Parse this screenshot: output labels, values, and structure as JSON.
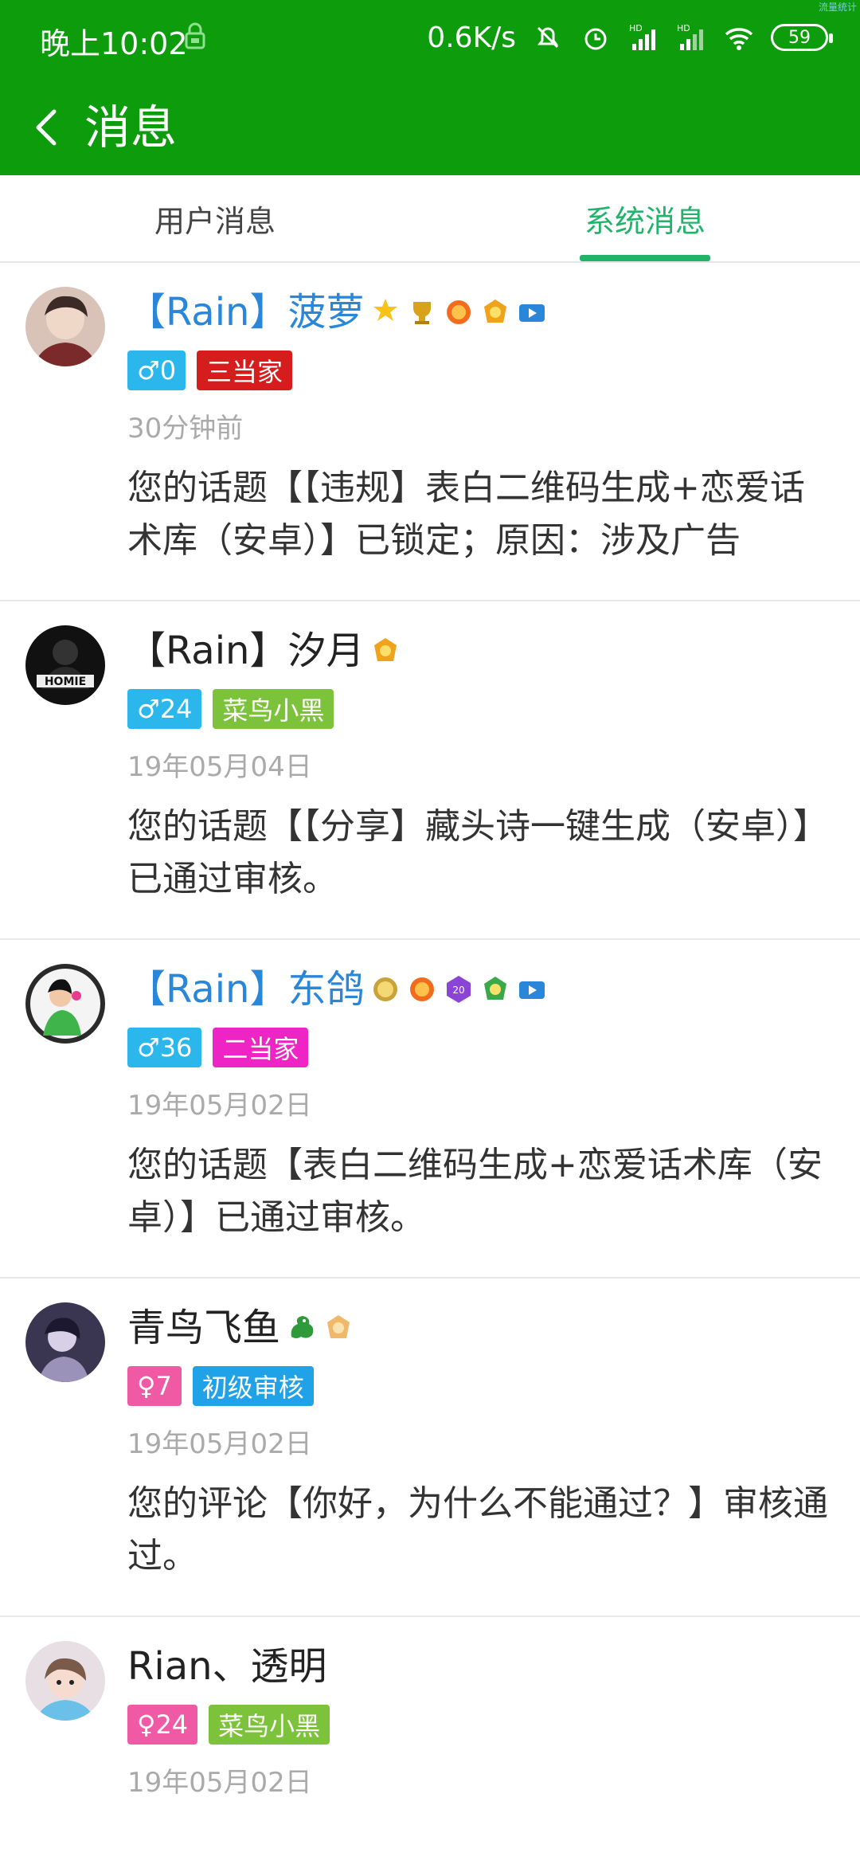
{
  "status_bar": {
    "time": "晚上10:02",
    "speed": "0.6K/s",
    "signal_1": "HD",
    "signal_2": "HD",
    "battery": "59",
    "top_right": "流量统计"
  },
  "app_bar": {
    "title": "消息"
  },
  "tabs": [
    {
      "label": "用户消息",
      "selected": false
    },
    {
      "label": "系统消息",
      "selected": true
    }
  ],
  "colors": {
    "primary": "#0c9c0c",
    "tab_active": "#21b36a",
    "name_blue": "#2a86d8"
  },
  "messages": [
    {
      "name": "【Rain】菠萝",
      "name_color": "blue",
      "gender": "♂",
      "level": "0",
      "role": "三当家",
      "time": "30分钟前",
      "text": "您的话题【【违规】表白二维码生成+恋爱话术库（安卓）】已锁定；原因：涉及广告"
    },
    {
      "name": "【Rain】汐月",
      "name_color": "black",
      "gender": "♂",
      "level": "24",
      "role": "菜鸟小黑",
      "time": "19年05月04日",
      "text": "您的话题【【分享】藏头诗一键生成（安卓）】已通过审核。"
    },
    {
      "name": "【Rain】东鸽",
      "name_color": "blue",
      "gender": "♂",
      "level": "36",
      "role": "二当家",
      "time": "19年05月02日",
      "text": "您的话题【表白二维码生成+恋爱话术库（安卓）】已通过审核。"
    },
    {
      "name": "青鸟飞鱼",
      "name_color": "black",
      "gender": "♀",
      "level": "7",
      "role": "初级审核",
      "time": "19年05月02日",
      "text": "您的评论【你好，为什么不能通过？】审核通过。"
    },
    {
      "name": "Rian、透明",
      "name_color": "black",
      "gender": "♀",
      "level": "24",
      "role": "菜鸟小黑",
      "time": "19年05月02日",
      "text": ""
    }
  ]
}
